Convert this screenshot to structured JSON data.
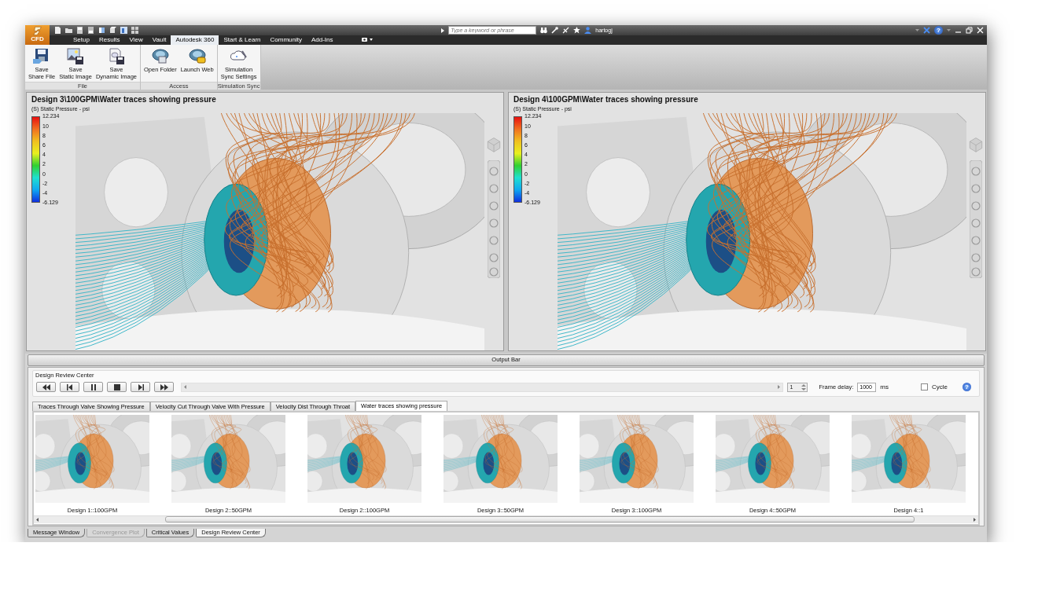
{
  "app_menu": {
    "label": "CFD"
  },
  "search": {
    "placeholder": "Type a keyword or phrase"
  },
  "user": {
    "name": "hartogj"
  },
  "help": {
    "label": "?"
  },
  "ribbon_tabs": [
    {
      "label": "Setup",
      "selected": false
    },
    {
      "label": "Results",
      "selected": false
    },
    {
      "label": "View",
      "selected": false
    },
    {
      "label": "Vault",
      "selected": false
    },
    {
      "label": "Autodesk 360",
      "selected": true
    },
    {
      "label": "Start & Learn",
      "selected": false
    },
    {
      "label": "Community",
      "selected": false
    },
    {
      "label": "Add-Ins",
      "selected": false
    }
  ],
  "ribbon_groups": [
    {
      "title": "File",
      "buttons": [
        {
          "label": "Save\nShare File",
          "kind": "share"
        },
        {
          "label": "Save\nStatic Image",
          "kind": "static"
        },
        {
          "label": "Save\nDynamic Image",
          "kind": "dynamic"
        }
      ]
    },
    {
      "title": "Access",
      "buttons": [
        {
          "label": "Open Folder",
          "kind": "folder"
        },
        {
          "label": "Launch Web",
          "kind": "web"
        }
      ]
    },
    {
      "title": "Simulation Sync",
      "buttons": [
        {
          "label": "Simulation\nSync Settings",
          "kind": "sync"
        }
      ]
    }
  ],
  "viewports": [
    {
      "title": "Design 3\\100GPM\\Water traces showing pressure",
      "legend_title": "(S) Static Pressure - psi",
      "legend_values": [
        "12.234",
        "10",
        "8",
        "6",
        "4",
        "2",
        "0",
        "-2",
        "-4",
        "-6.129"
      ]
    },
    {
      "title": "Design 4\\100GPM\\Water traces showing pressure",
      "legend_title": "(S) Static Pressure - psi",
      "legend_values": [
        "12.234",
        "10",
        "8",
        "6",
        "4",
        "2",
        "0",
        "-2",
        "-4",
        "-6.129"
      ]
    }
  ],
  "output_bar": {
    "label": "Output Bar"
  },
  "design_review": {
    "title": "Design Review Center",
    "frame": "1",
    "frame_delay_label": "Frame delay:",
    "frame_delay": "1000",
    "unit": "ms",
    "cycle": {
      "label": "Cycle",
      "checked": false
    },
    "help": "?",
    "tabs": [
      {
        "label": "Traces Through Valve Showing Pressure",
        "selected": false
      },
      {
        "label": "Velocity Cut Through Valve With Pressure",
        "selected": false
      },
      {
        "label": "Velocity Dist Through Throat",
        "selected": false
      },
      {
        "label": "Water traces showing pressure",
        "selected": true
      }
    ],
    "thumbnails": [
      {
        "caption": "Design 1::100GPM"
      },
      {
        "caption": "Design 2::50GPM"
      },
      {
        "caption": "Design 2::100GPM"
      },
      {
        "caption": "Design 3::50GPM"
      },
      {
        "caption": "Design 3::100GPM"
      },
      {
        "caption": "Design 4::50GPM"
      },
      {
        "caption": "Design 4::1"
      }
    ]
  },
  "bottom_tabs": [
    {
      "label": "Message Window",
      "selected": false,
      "disabled": false
    },
    {
      "label": "Convergence Plot",
      "selected": false,
      "disabled": true
    },
    {
      "label": "Critical Values",
      "selected": false,
      "disabled": false
    },
    {
      "label": "Design Review Center",
      "selected": true,
      "disabled": false
    }
  ]
}
